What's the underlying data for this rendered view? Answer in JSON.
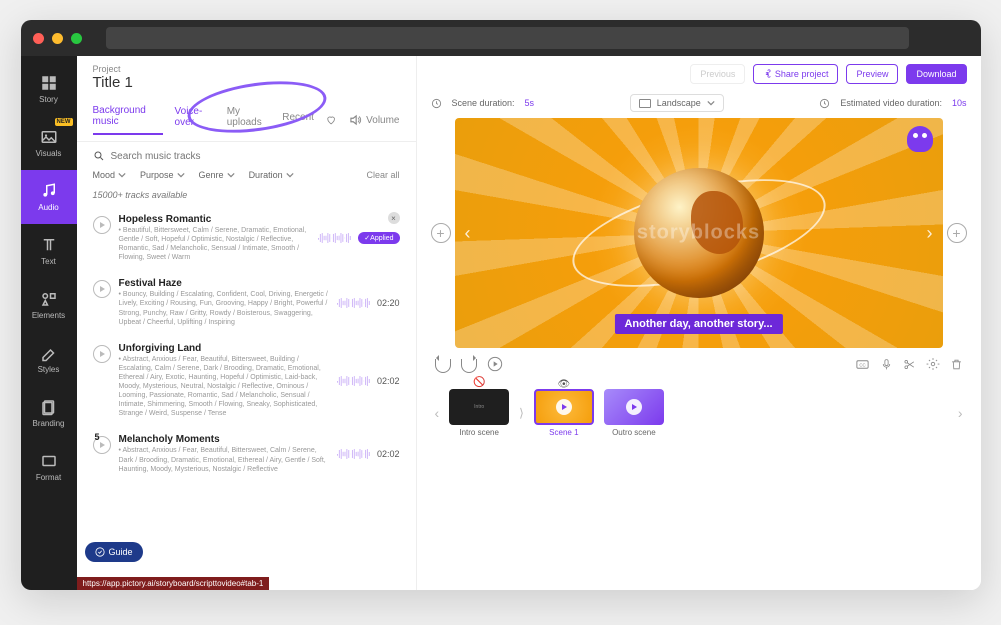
{
  "project": {
    "label": "Project",
    "title": "Title 1"
  },
  "sidenav": {
    "items": [
      {
        "label": "Story",
        "active": false
      },
      {
        "label": "Visuals",
        "badge": "NEW",
        "active": false
      },
      {
        "label": "Audio",
        "active": true
      },
      {
        "label": "Text",
        "active": false
      },
      {
        "label": "Elements",
        "active": false
      },
      {
        "label": "Styles",
        "active": false
      },
      {
        "label": "Branding",
        "active": false
      },
      {
        "label": "Format",
        "active": false
      }
    ]
  },
  "audio": {
    "tabs": {
      "bg_music": "Background music",
      "voice_over": "Voice-over",
      "my_uploads": "My uploads",
      "recent": "Recent",
      "volume": "Volume"
    },
    "search_placeholder": "Search music tracks",
    "filters": {
      "mood": "Mood",
      "purpose": "Purpose",
      "genre": "Genre",
      "duration": "Duration",
      "clear": "Clear all"
    },
    "count": "15000+ tracks available",
    "applied_label": "Applied",
    "tracks": [
      {
        "title": "Hopeless Romantic",
        "tags": "• Beautiful, Bittersweet, Calm / Serene, Dramatic, Emotional, Gentle / Soft, Hopeful / Optimistic, Nostalgic / Reflective, Romantic, Sad / Melancholic, Sensual / Intimate, Smooth / Flowing, Sweet / Warm",
        "applied": true,
        "dur": ""
      },
      {
        "title": "Festival Haze",
        "tags": "• Bouncy, Building / Escalating, Confident, Cool, Driving, Energetic / Lively, Exciting / Rousing, Fun, Grooving, Happy / Bright, Powerful / Strong, Punchy, Raw / Gritty, Rowdy / Boisterous, Swaggering, Upbeat / Cheerful, Uplifting / Inspiring",
        "applied": false,
        "dur": "02:20"
      },
      {
        "title": "Unforgiving Land",
        "tags": "• Abstract, Anxious / Fear, Beautiful, Bittersweet, Building / Escalating, Calm / Serene, Dark / Brooding, Dramatic, Emotional, Ethereal / Airy, Exotic, Haunting, Hopeful / Optimistic, Laid-back, Moody, Mysterious, Neutral, Nostalgic / Reflective, Ominous / Looming, Passionate, Romantic, Sad / Melancholic, Sensual / Intimate, Shimmering, Smooth / Flowing, Sneaky, Sophisticated, Strange / Weird, Suspense / Tense",
        "applied": false,
        "dur": "02:02"
      },
      {
        "title": "Melancholy Moments",
        "tags": "• Abstract, Anxious / Fear, Beautiful, Bittersweet, Calm / Serene, Dark / Brooding, Dramatic, Emotional, Ethereal / Airy, Gentle / Soft, Haunting, Moody, Mysterious, Nostalgic / Reflective",
        "applied": false,
        "dur": "02:02",
        "num": "5"
      }
    ]
  },
  "toolbar": {
    "previous": "Previous",
    "share": "Share project",
    "preview": "Preview",
    "download": "Download"
  },
  "meta": {
    "scene_dur_label": "Scene duration:",
    "scene_dur_val": "5s",
    "aspect": "Landscape",
    "est_label": "Estimated video duration:",
    "est_val": "10s"
  },
  "preview": {
    "caption": "Another day, another story...",
    "watermark": "storyblocks"
  },
  "scenes": {
    "items": [
      {
        "label": "Intro scene",
        "kind": "intro",
        "visible": false
      },
      {
        "label": "Scene 1",
        "kind": "s1",
        "visible": true,
        "active": true
      },
      {
        "label": "Outro scene",
        "kind": "outro",
        "visible": true
      }
    ]
  },
  "guide": "Guide",
  "urlhint": "https://app.pictory.ai/storyboard/scripttovideo#tab-1"
}
